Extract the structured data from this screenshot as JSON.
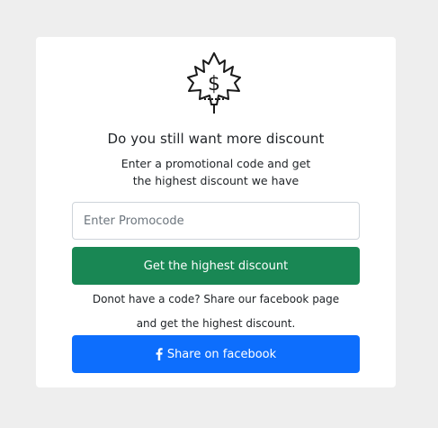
{
  "card": {
    "logo_icon": "maple-leaf-dollar-icon",
    "heading": "Do you still want more discount",
    "subtext_line1": "Enter a promotional code and get",
    "subtext_line2": "the highest discount we have"
  },
  "promo": {
    "placeholder": "Enter Promocode",
    "value": ""
  },
  "buttons": {
    "get_discount_label": "Get the highest discount",
    "share_label": "Share on facebook",
    "share_icon": "facebook-icon"
  },
  "note": {
    "line1": "Donot have a code? Share our facebook page",
    "line2": "and get the highest discount."
  },
  "colors": {
    "background": "#eeeeee",
    "card": "#ffffff",
    "success": "#198754",
    "primary": "#0d6efd"
  }
}
